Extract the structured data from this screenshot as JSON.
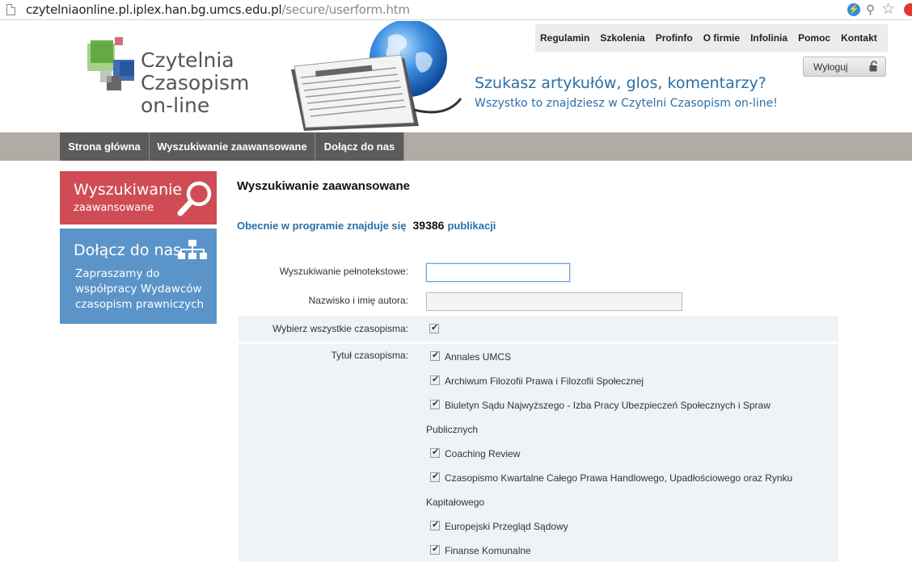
{
  "browser": {
    "url_host": "czytelniaonline.pl.iplex.han.bg.umcs.edu.pl",
    "url_path": "/secure/userform.htm"
  },
  "header": {
    "logo_lines": [
      "Czytelnia",
      "Czasopism",
      "on-line"
    ],
    "tagline_1": "Szukasz artykułów, glos, komentarzy?",
    "tagline_2": "Wszystko to znajdziesz w Czytelni Czasopism on-line!",
    "top_nav": [
      "Regulamin",
      "Szkolenia",
      "Profinfo",
      "O firmie",
      "Infolinia",
      "Pomoc",
      "Kontakt"
    ],
    "logout_label": "Wyloguj"
  },
  "main_nav": [
    "Strona główna",
    "Wyszukiwanie zaawansowane",
    "Dołącz do nas"
  ],
  "sidebar": {
    "search_box": {
      "title": "Wyszukiwanie",
      "subtitle": "zaawansowane"
    },
    "join_box": {
      "title": "Dołącz do nas",
      "text": "Zapraszamy do współpracy Wydawców czasopism prawniczych"
    }
  },
  "content": {
    "title": "Wyszukiwanie zaawansowane",
    "count_prefix": "Obecnie w programie znajduje się",
    "count_value": "39386",
    "count_suffix": "publikacji",
    "fulltext_label": "Wyszukiwanie pełnotekstowe:",
    "fulltext_value": "",
    "author_label": "Nazwisko i imię autora:",
    "author_value": "",
    "select_all_label": "Wybierz wszystkie czasopisma:",
    "select_all_checked": true,
    "journal_title_label": "Tytuł czasopisma:",
    "journals": [
      "Annales UMCS",
      "Archiwum Filozofii Prawa i Filozofii Społecznej",
      "Biuletyn Sądu Najwyższego - Izba Pracy Ubezpieczeń Społecznych i Spraw",
      "Coaching Review",
      "Czasopismo Kwartalne Całego Prawa Handlowego, Upadłościowego oraz Rynku",
      "Europejski Przegląd Sądowy",
      "Finanse Komunalne"
    ],
    "journal_continuations": [
      "Publicznych",
      "Kapitałowego"
    ]
  },
  "colors": {
    "red_box": "#d04c55",
    "blue_box": "#5b94c8",
    "link_blue": "#2a6fa8",
    "nav_dark": "#5c5c5c",
    "nav_bar": "#b0aba5"
  },
  "icons": [
    "page-icon",
    "extension-icon",
    "key-icon",
    "star-icon",
    "stop-icon",
    "lock-icon",
    "magnifier-icon",
    "network-icon",
    "globe-newspaper-image"
  ]
}
